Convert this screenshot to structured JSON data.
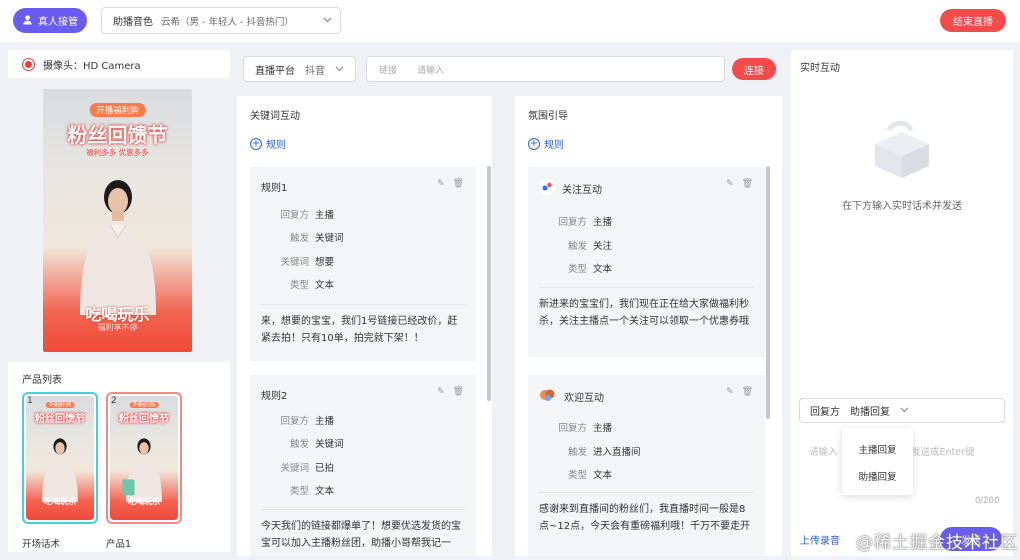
{
  "header": {
    "live_button": "真人接管",
    "voice_label": "助播音色",
    "voice_value": "云希（男 - 年轻人 - 抖音热门）",
    "end_button": "结束直播"
  },
  "camera": {
    "label": "摄像头：HD Camera"
  },
  "poster": {
    "tag": "开播福利购",
    "title": "粉丝回馈节",
    "subtitle": "福利多多 优惠多多",
    "bottom_title": "吃喝玩乐",
    "bottom_sub": "福利享不停"
  },
  "products": {
    "title": "产品列表",
    "items": [
      {
        "num": "1",
        "caption": "开场话术"
      },
      {
        "num": "2",
        "caption": "产品1"
      }
    ]
  },
  "controls": {
    "platform_label": "直播平台",
    "platform_value": "抖音",
    "link_label": "链接",
    "link_placeholder": "请输入",
    "connect": "连接"
  },
  "keyword": {
    "title": "关键词互动",
    "add_rule": "规则",
    "rules": [
      {
        "name": "规则1",
        "replier": "主播",
        "trigger": "关键词",
        "keyword": "想要",
        "type": "文本",
        "content": "来，想要的宝宝，我们1号链接已经改价，赶紧去拍！只有10单，拍完就下架！！"
      },
      {
        "name": "规则2",
        "replier": "主播",
        "trigger": "关键词",
        "keyword": "已拍",
        "type": "文本",
        "content": "今天我们的链接都爆单了！想要优选发货的宝宝可以加入主播粉丝团，助播小哥帮我记一"
      }
    ],
    "labels": {
      "replier": "回复方",
      "trigger": "触发",
      "keyword": "关键词",
      "type": "类型"
    }
  },
  "atmosphere": {
    "title": "氛围引导",
    "add_rule": "规则",
    "rules": [
      {
        "name": "关注互动",
        "replier": "主播",
        "trigger": "关注",
        "type": "文本",
        "content": "新进来的宝宝们，我们现在正在给大家做福利秒杀，关注主播点一个关注可以领取一个优惠券哦"
      },
      {
        "name": "欢迎互动",
        "replier": "主播",
        "trigger": "进入直播间",
        "type": "文本",
        "content": "感谢来到直播间的粉丝们，我直播时间一般是8点~12点，今天会有重磅福利哦！千万不要走开"
      }
    ],
    "labels": {
      "replier": "回复方",
      "trigger": "触发",
      "type": "类型"
    }
  },
  "realtime": {
    "title": "实时互动",
    "empty": "在下方输入实时话术并发送",
    "reply_label": "回复方",
    "reply_value": "助播回复",
    "input_left": "请输入",
    "input_right": "发送或Enter键",
    "counter": "0/200",
    "upload": "上传录音",
    "send": "发送",
    "options": [
      "主播回复",
      "助播回复"
    ]
  },
  "watermark": "@稀土掘金技术社区"
}
